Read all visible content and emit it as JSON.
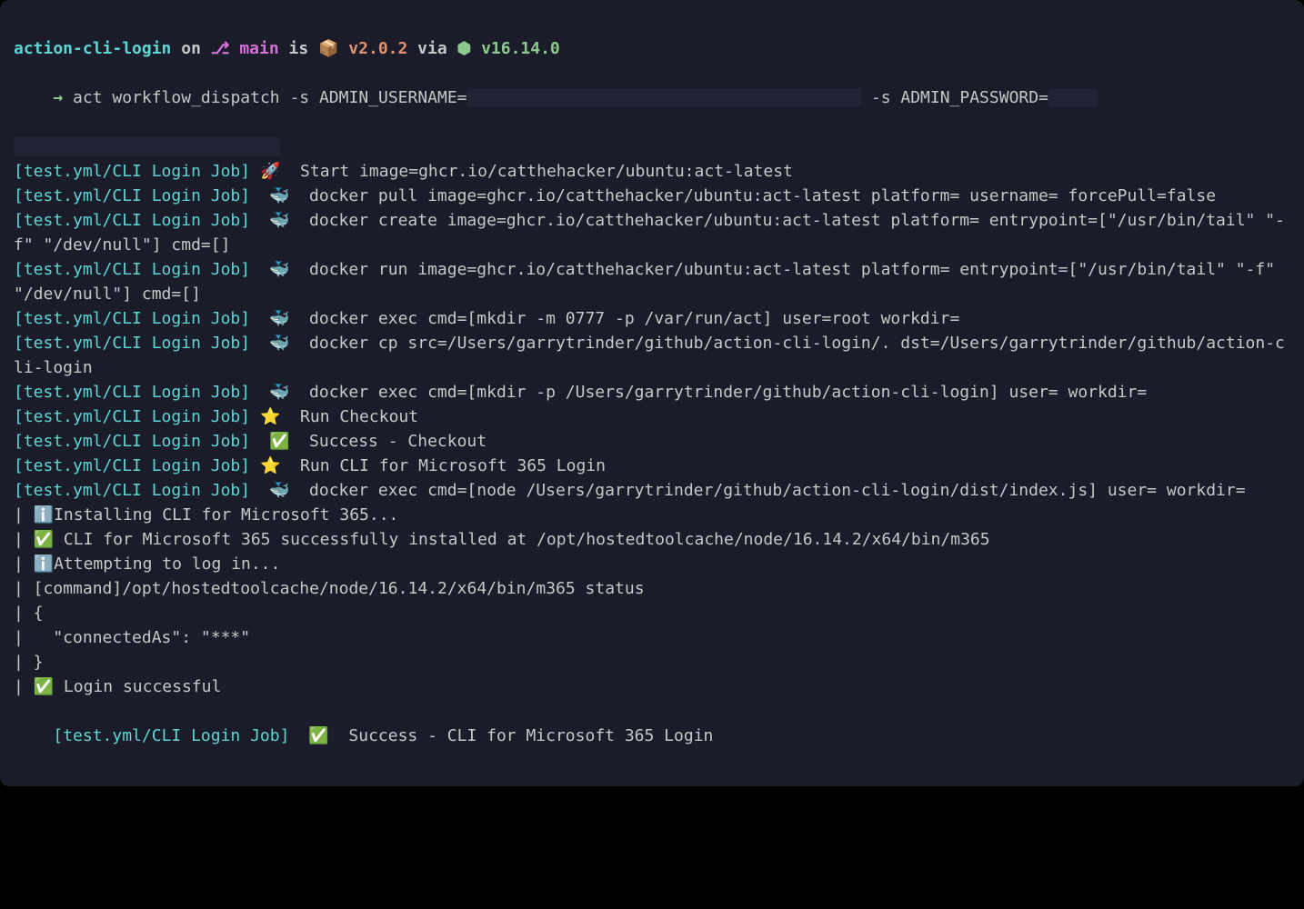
{
  "prompt": {
    "project": "action-cli-login",
    "on": " on ",
    "branch_icon": "",
    "branch": "main",
    "is": " is ",
    "pkg_icon": "📦",
    "version": " v2.0.2",
    "via": " via ",
    "node_icon": "⬢",
    "node_version": " v16.14.0"
  },
  "cmd": {
    "arrow": "→ ",
    "text": "act workflow_dispatch -s ADMIN_USERNAME=",
    "redacted1": "                                        ",
    "tail": " -s ADMIN_PASSWORD=",
    "redacted2": "     "
  },
  "redacted_line2": "                           ",
  "prefix": "[test.yml/CLI Login Job]",
  "lines": [
    {
      "icon": "🚀",
      "text": " Start image=ghcr.io/catthehacker/ubuntu:act-latest"
    },
    {
      "icon": "  🐳",
      "text": " docker pull image=ghcr.io/catthehacker/ubuntu:act-latest platform= username= forcePull=false"
    },
    {
      "icon": "  🐳",
      "text": " docker create image=ghcr.io/catthehacker/ubuntu:act-latest platform= entrypoint=[\"/usr/bin/tail\" \"-f\" \"/dev/null\"] cmd=[]"
    },
    {
      "icon": "  🐳",
      "text": " docker run image=ghcr.io/catthehacker/ubuntu:act-latest platform= entrypoint=[\"/usr/bin/tail\" \"-f\" \"/dev/null\"] cmd=[]"
    },
    {
      "icon": "  🐳",
      "text": " docker exec cmd=[mkdir -m 0777 -p /var/run/act] user=root workdir="
    },
    {
      "icon": "  🐳",
      "text": " docker cp src=/Users/garrytrinder/github/action-cli-login/. dst=/Users/garrytrinder/github/action-cli-login"
    },
    {
      "icon": "  🐳",
      "text": " docker exec cmd=[mkdir -p /Users/garrytrinder/github/action-cli-login] user= workdir="
    },
    {
      "icon": "⭐",
      "text": " Run Checkout"
    },
    {
      "icon": "  ✅",
      "text": " Success - Checkout"
    },
    {
      "icon": "⭐",
      "text": " Run CLI for Microsoft 365 Login"
    },
    {
      "icon": "  🐳",
      "text": " docker exec cmd=[node /Users/garrytrinder/github/action-cli-login/dist/index.js] user= workdir="
    }
  ],
  "pipes": [
    "| ℹ️Installing CLI for Microsoft 365...",
    "| ✅ CLI for Microsoft 365 successfully installed at /opt/hostedtoolcache/node/16.14.2/x64/bin/m365",
    "| ℹ️Attempting to log in...",
    "| [command]/opt/hostedtoolcache/node/16.14.2/x64/bin/m365 status",
    "| {",
    "|   \"connectedAs\": \"***\"",
    "| }",
    "| ✅ Login successful"
  ],
  "final": {
    "icon": "  ✅",
    "text": " Success - CLI for Microsoft 365 Login"
  },
  "branch_glyph": "⎇"
}
